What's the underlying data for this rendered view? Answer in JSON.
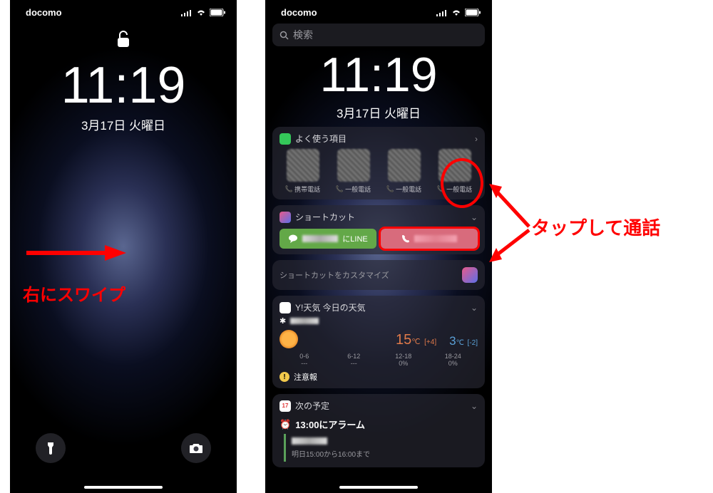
{
  "statusbar": {
    "carrier": "docomo"
  },
  "clock": {
    "time": "11:19",
    "date": "3月17日 火曜日"
  },
  "search": {
    "placeholder": "検索"
  },
  "favorites": {
    "title": "よく使う項目",
    "items": [
      {
        "label": "携帯電話"
      },
      {
        "label": "一般電話"
      },
      {
        "label": "一般電話"
      },
      {
        "label": "一般電話"
      }
    ]
  },
  "shortcuts": {
    "title": "ショートカット",
    "line_label": "にLINE",
    "customize": "ショートカットをカスタマイズ"
  },
  "weather": {
    "title": "Y!天気 今日の天気",
    "hi": "15",
    "hi_unit": "℃",
    "hi_diff": "[+4]",
    "lo": "3",
    "lo_unit": "℃",
    "lo_diff": "[-2]",
    "slots": [
      "0-6",
      "6-12",
      "12-18",
      "18-24"
    ],
    "pct": [
      "---",
      "---",
      "0%",
      "0%"
    ],
    "caution": "注意報"
  },
  "calendar": {
    "day": "17",
    "title": "次の予定",
    "alarm": "13:00にアラーム",
    "sub": "明日15:00から16:00まで"
  },
  "annotations": {
    "swipe_right": "右にスワイプ",
    "tap_call": "タップして通話"
  }
}
